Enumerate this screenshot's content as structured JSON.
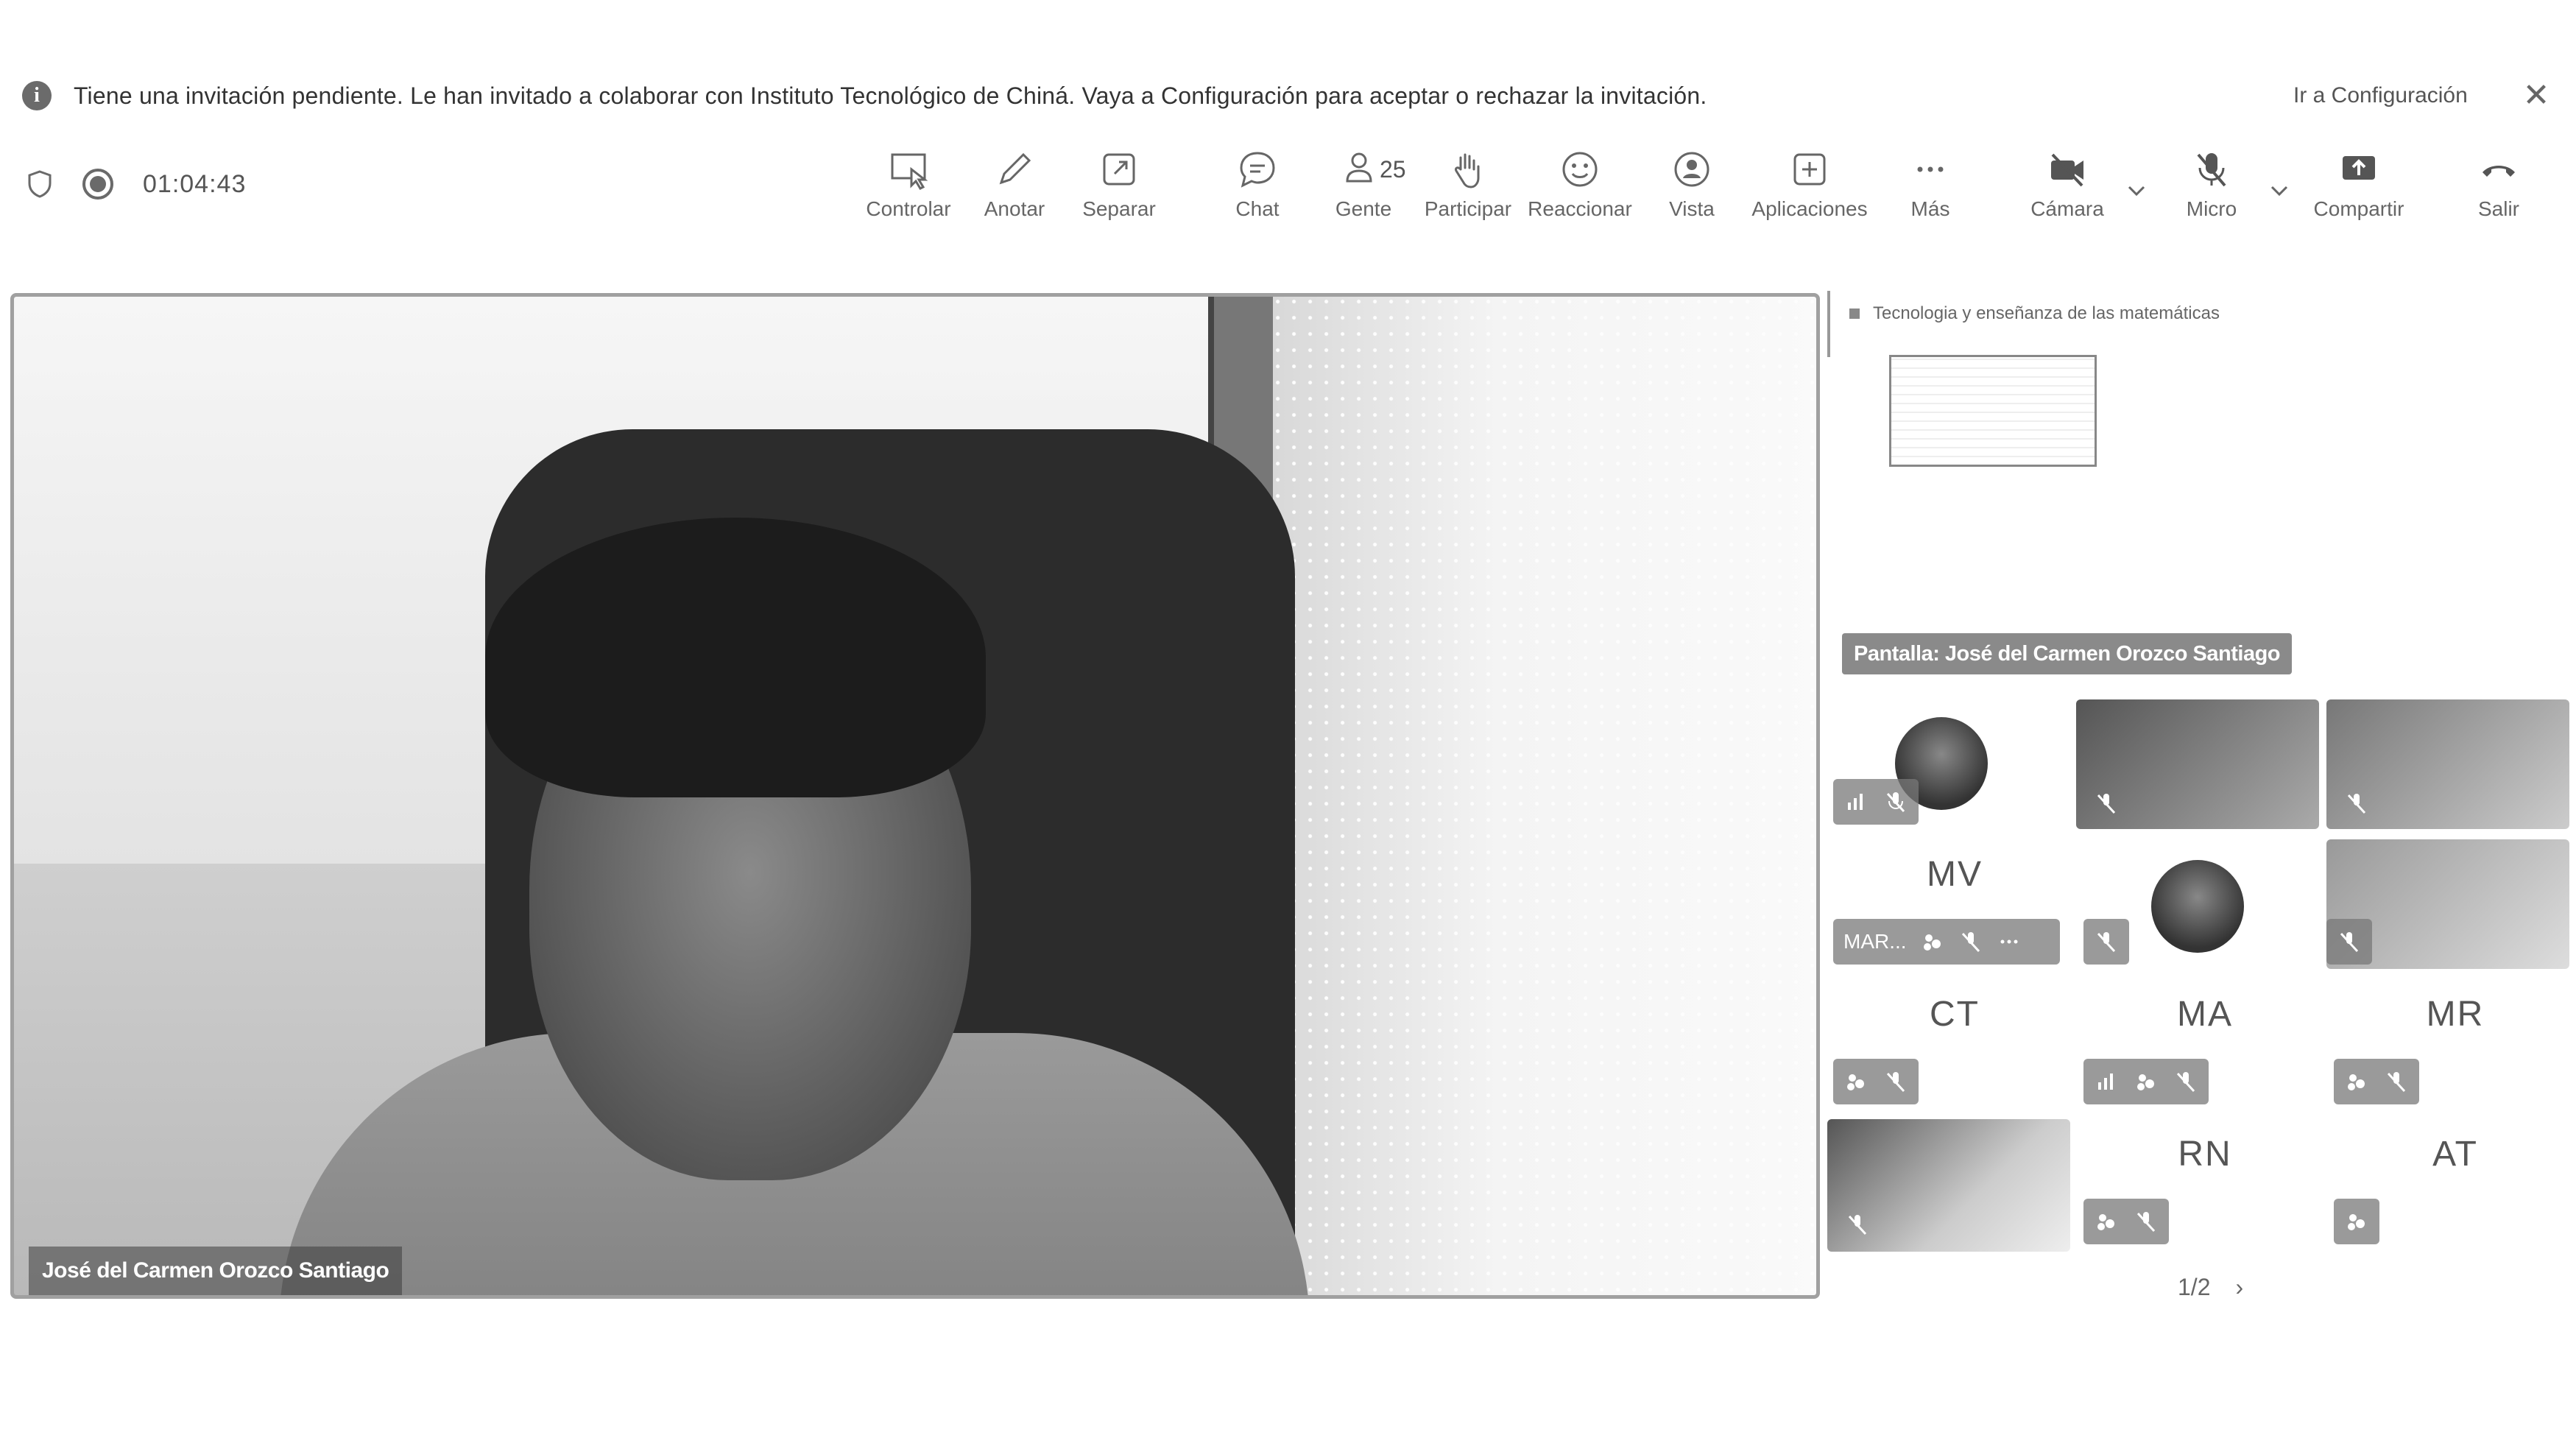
{
  "banner": {
    "message": "Tiene una invitación pendiente. Le han invitado a colaborar con Instituto Tecnológico de Chiná. Vaya a Configuración para aceptar o rechazar la invitación.",
    "action": "Ir a Configuración"
  },
  "status": {
    "timer": "01:04:43"
  },
  "toolbar": {
    "control": "Controlar",
    "annotate": "Anotar",
    "separate": "Separar",
    "chat": "Chat",
    "people": "Gente",
    "people_count": "25",
    "participate": "Participar",
    "react": "Reaccionar",
    "view": "Vista",
    "apps": "Aplicaciones",
    "more": "Más",
    "camera": "Cámara",
    "mic": "Micro",
    "share": "Compartir",
    "leave": "Salir"
  },
  "main": {
    "speaker_name": "José del Carmen Orozco Santiago"
  },
  "side": {
    "shared_title": "Tecnologia y enseñanza de las matemáticas",
    "screen_label": "Pantalla: José del Carmen Orozco Santiago",
    "participants": [
      {
        "initials": ""
      },
      {
        "initials": ""
      },
      {
        "initials": ""
      },
      {
        "initials": "MV",
        "name": "MAR..."
      },
      {
        "initials": ""
      },
      {
        "initials": ""
      },
      {
        "initials": "CT"
      },
      {
        "initials": "MA"
      },
      {
        "initials": "MR"
      },
      {
        "initials": ""
      },
      {
        "initials": "RN"
      },
      {
        "initials": "AT"
      }
    ],
    "pager": "1/2"
  },
  "colors": {
    "accent": "#8a8a8a",
    "text": "#3a3a3a"
  }
}
